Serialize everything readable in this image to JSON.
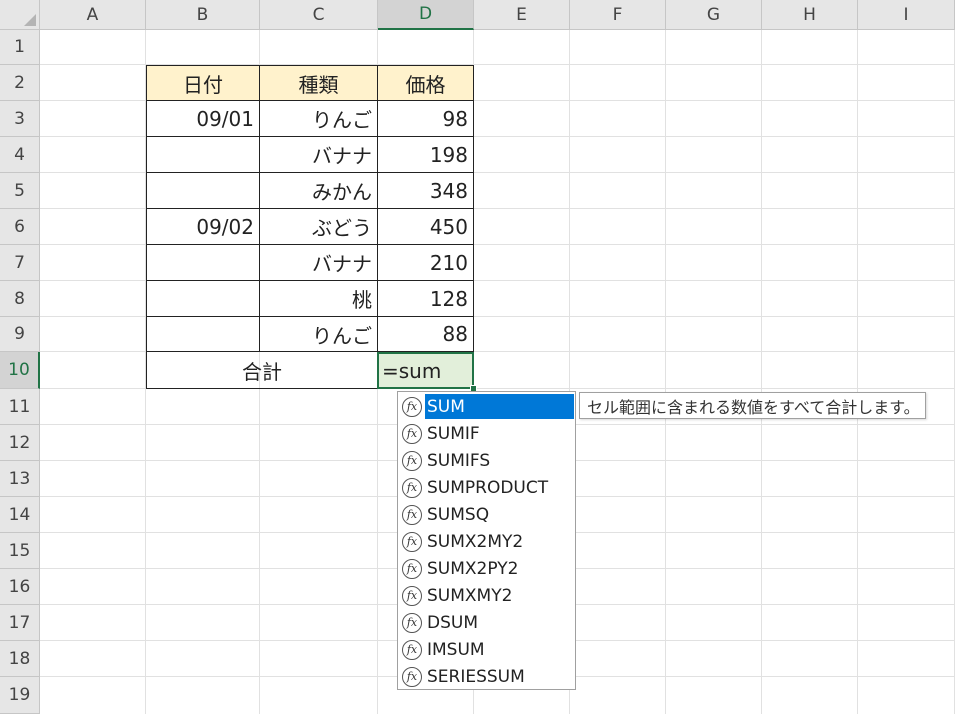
{
  "columns": [
    "A",
    "B",
    "C",
    "D",
    "E",
    "F",
    "G",
    "H",
    "I"
  ],
  "rows": [
    "1",
    "2",
    "3",
    "4",
    "5",
    "6",
    "7",
    "8",
    "9",
    "10",
    "11",
    "12",
    "13",
    "14",
    "15",
    "16",
    "17",
    "18",
    "19"
  ],
  "active_cell": {
    "column": "D",
    "row": "10"
  },
  "table": {
    "headers": [
      "日付",
      "種類",
      "価格"
    ],
    "rows": [
      {
        "date": "09/01",
        "kind": "りんご",
        "price": "98"
      },
      {
        "date": "",
        "kind": "バナナ",
        "price": "198"
      },
      {
        "date": "",
        "kind": "みかん",
        "price": "348"
      },
      {
        "date": "09/02",
        "kind": "ぶどう",
        "price": "450"
      },
      {
        "date": "",
        "kind": "バナナ",
        "price": "210"
      },
      {
        "date": "",
        "kind": "桃",
        "price": "128"
      },
      {
        "date": "",
        "kind": "りんご",
        "price": "88"
      }
    ],
    "total_label": "合計"
  },
  "formula_input": "=sum",
  "autocomplete": {
    "selected_index": 0,
    "items": [
      "SUM",
      "SUMIF",
      "SUMIFS",
      "SUMPRODUCT",
      "SUMSQ",
      "SUMX2MY2",
      "SUMX2PY2",
      "SUMXMY2",
      "DSUM",
      "IMSUM",
      "SERIESSUM"
    ],
    "tooltip": "セル範囲に含まれる数値をすべて合計します。"
  },
  "colors": {
    "accent": "#217346",
    "header_fill": "#fff2cc",
    "selection": "#0078d7",
    "editing_fill": "#e2efda"
  }
}
